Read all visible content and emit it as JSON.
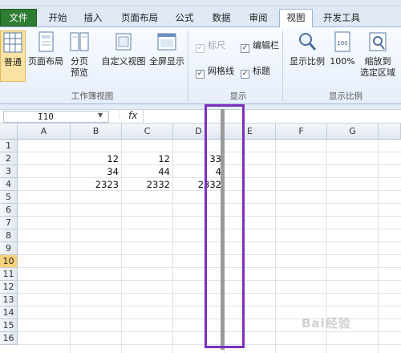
{
  "tabs": [
    "文件",
    "开始",
    "插入",
    "页面布局",
    "公式",
    "数据",
    "审阅",
    "视图",
    "开发工具"
  ],
  "ribbon": {
    "normal": "普通",
    "page_layout": "页面布局",
    "page_break_1": "分页",
    "page_break_2": "预览",
    "custom_view": "自定义视图",
    "full_screen": "全屏显示",
    "group_views": "工作簿视图",
    "ruler": "标尺",
    "gridlines": "网格线",
    "formula_bar": "编辑栏",
    "headings": "标题",
    "group_show": "显示",
    "zoom": "显示比例",
    "zoom100": "100%",
    "zoom_sel_1": "缩放到",
    "zoom_sel_2": "选定区域",
    "group_zoom": "显示比例"
  },
  "formula_bar": {
    "cell_ref": "I10",
    "fx": "fx"
  },
  "columns": [
    "A",
    "B",
    "C",
    "D",
    "E",
    "F",
    "G"
  ],
  "rows": [
    "1",
    "2",
    "3",
    "4",
    "5",
    "6",
    "7",
    "8",
    "9",
    "10",
    "11",
    "12",
    "13",
    "14",
    "15",
    "16"
  ],
  "selected_row": "10",
  "cells": {
    "b2": "12",
    "c2": "12",
    "d2": "33",
    "b3": "34",
    "c3": "44",
    "d3": "4",
    "b4": "2323",
    "c4": "2332",
    "d4": "2332"
  },
  "watermark": "Bai经验",
  "colors": {
    "file_tab": "#2e7d32",
    "highlight": "#7a2fbf",
    "selected_row": "#f7d27a"
  }
}
